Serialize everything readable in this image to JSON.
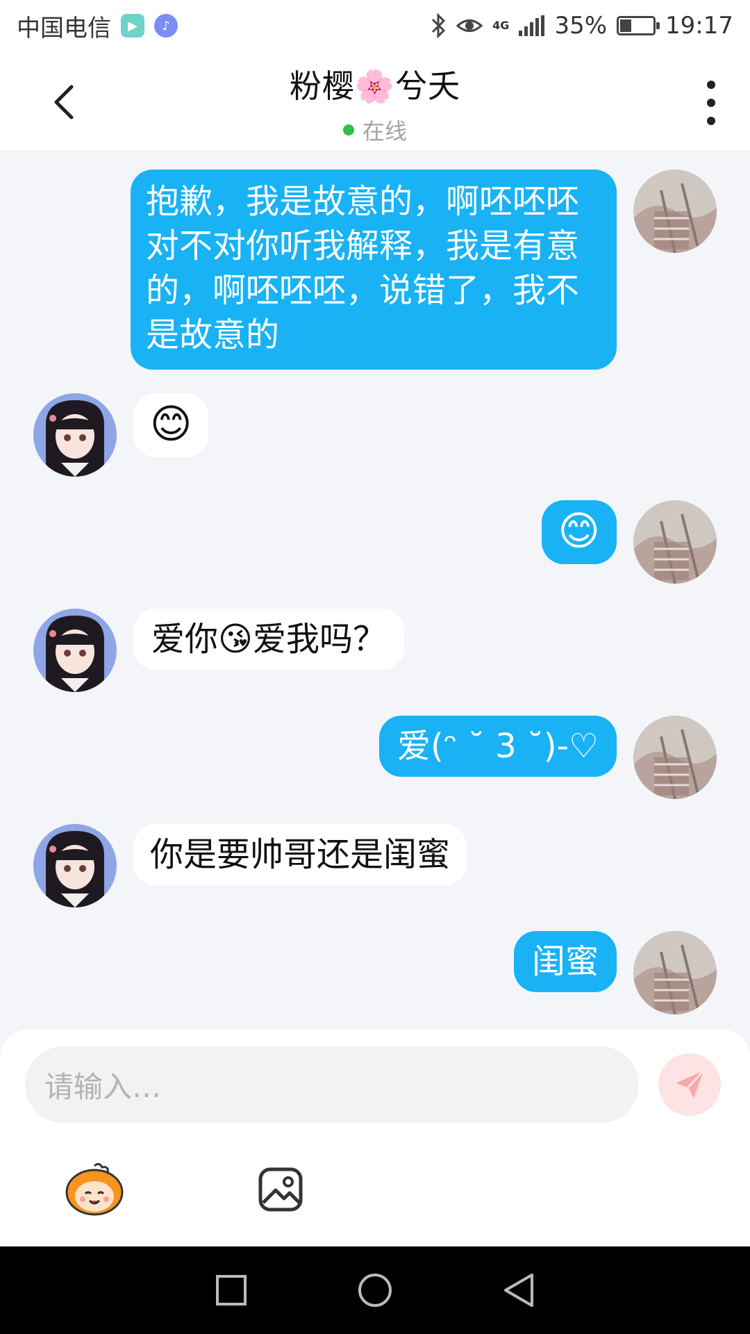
{
  "status_bar": {
    "carrier": "中国电信",
    "network": "4G",
    "battery_percent": "35%",
    "battery_level": 0.35,
    "time": "19:17",
    "icons": [
      "video-app-icon",
      "music-app-icon",
      "bluetooth-icon",
      "eye-icon",
      "signal-icon",
      "battery-icon"
    ]
  },
  "header": {
    "title": "粉樱🌸兮夭",
    "presence": "在线",
    "presence_color": "#2fbf4a"
  },
  "messages": [
    {
      "direction": "out",
      "text": "抱歉，我是故意的，啊呸呸呸对不对你听我解释，我是有意的，啊呸呸呸，说错了，我不是故意的"
    },
    {
      "direction": "in",
      "text": "😊"
    },
    {
      "direction": "out",
      "text": "😊"
    },
    {
      "direction": "in",
      "text": "爱你😘爱我吗？"
    },
    {
      "direction": "out",
      "text": "爱(ᵔ ˘ 3 ˘)-♡"
    },
    {
      "direction": "in",
      "text": "你是要帅哥还是闺蜜"
    },
    {
      "direction": "out",
      "text": "闺蜜"
    }
  ],
  "composer": {
    "placeholder": "请输入…",
    "send_icon": "send-icon",
    "tools": [
      "sticker-icon",
      "image-icon"
    ]
  },
  "nav_bar": {
    "icons": [
      "recent-apps-icon",
      "home-icon",
      "back-icon"
    ]
  },
  "colors": {
    "outgoing_bubble": "#18b2f5",
    "incoming_bubble": "#ffffff",
    "background": "#f3f5f9",
    "send_button": "#fde3e3"
  }
}
